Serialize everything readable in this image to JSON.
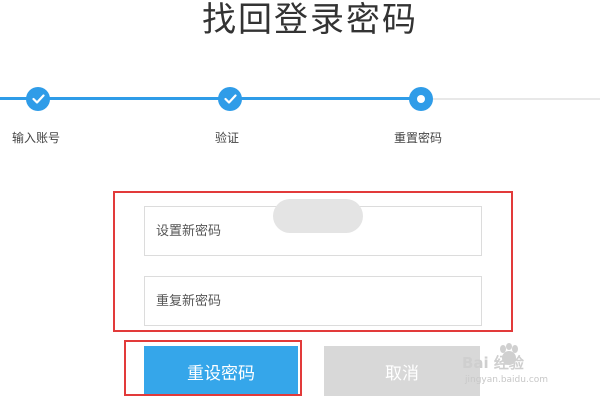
{
  "page": {
    "title": "找回登录密码"
  },
  "steps": [
    {
      "label": "输入账号",
      "state": "done"
    },
    {
      "label": "验证",
      "state": "done"
    },
    {
      "label": "重置密码",
      "state": "current"
    },
    {
      "label": "",
      "state": "pending"
    }
  ],
  "form": {
    "new_password_placeholder": "设置新密码",
    "repeat_password_placeholder": "重复新密码",
    "reset_label": "重设密码",
    "cancel_label": "取消"
  },
  "watermark": {
    "text": "Bai 经验",
    "sub": "jingyan.baidu.com"
  },
  "colors": {
    "accent": "#2f9ce8",
    "primary_button": "#35a6ea",
    "disabled_button": "#d8d8d8",
    "annotation": "#e23a3a"
  },
  "icons": {
    "done_step": "check-icon",
    "current_step": "dot-icon"
  }
}
